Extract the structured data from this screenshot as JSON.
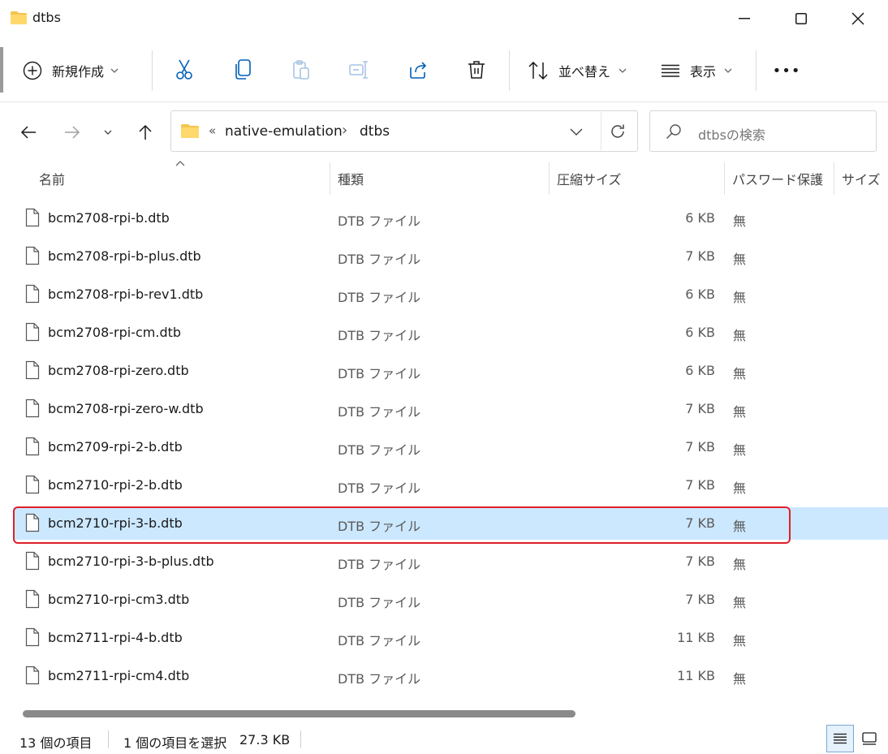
{
  "window": {
    "title": "dtbs"
  },
  "toolbar": {
    "new_label": "新規作成",
    "sort_label": "並べ替え",
    "view_label": "表示",
    "more_label": "•••"
  },
  "address": {
    "overflow": "«",
    "crumbs": [
      "native-emulation",
      "dtbs"
    ],
    "chevron": "›"
  },
  "search": {
    "placeholder": "dtbsの検索"
  },
  "columns": {
    "name": "名前",
    "type": "種類",
    "compressed_size": "圧縮サイズ",
    "password": "パスワード保護",
    "size": "サイズ"
  },
  "files": [
    {
      "name": "bcm2708-rpi-b.dtb",
      "type": "DTB ファイル",
      "size": "6 KB",
      "protected": "無"
    },
    {
      "name": "bcm2708-rpi-b-plus.dtb",
      "type": "DTB ファイル",
      "size": "7 KB",
      "protected": "無"
    },
    {
      "name": "bcm2708-rpi-b-rev1.dtb",
      "type": "DTB ファイル",
      "size": "6 KB",
      "protected": "無"
    },
    {
      "name": "bcm2708-rpi-cm.dtb",
      "type": "DTB ファイル",
      "size": "6 KB",
      "protected": "無"
    },
    {
      "name": "bcm2708-rpi-zero.dtb",
      "type": "DTB ファイル",
      "size": "6 KB",
      "protected": "無"
    },
    {
      "name": "bcm2708-rpi-zero-w.dtb",
      "type": "DTB ファイル",
      "size": "7 KB",
      "protected": "無"
    },
    {
      "name": "bcm2709-rpi-2-b.dtb",
      "type": "DTB ファイル",
      "size": "7 KB",
      "protected": "無"
    },
    {
      "name": "bcm2710-rpi-2-b.dtb",
      "type": "DTB ファイル",
      "size": "7 KB",
      "protected": "無"
    },
    {
      "name": "bcm2710-rpi-3-b.dtb",
      "type": "DTB ファイル",
      "size": "7 KB",
      "protected": "無",
      "selected": true
    },
    {
      "name": "bcm2710-rpi-3-b-plus.dtb",
      "type": "DTB ファイル",
      "size": "7 KB",
      "protected": "無"
    },
    {
      "name": "bcm2710-rpi-cm3.dtb",
      "type": "DTB ファイル",
      "size": "7 KB",
      "protected": "無"
    },
    {
      "name": "bcm2711-rpi-4-b.dtb",
      "type": "DTB ファイル",
      "size": "11 KB",
      "protected": "無"
    },
    {
      "name": "bcm2711-rpi-cm4.dtb",
      "type": "DTB ファイル",
      "size": "11 KB",
      "protected": "無"
    }
  ],
  "status": {
    "item_count": "13 個の項目",
    "selection": "1 個の項目を選択",
    "selection_size": "27.3 KB"
  },
  "colors": {
    "accent": "#0067c0",
    "selection_bg": "#cce8ff",
    "highlight_border": "#e0202a",
    "folder": "#f4c44e"
  }
}
